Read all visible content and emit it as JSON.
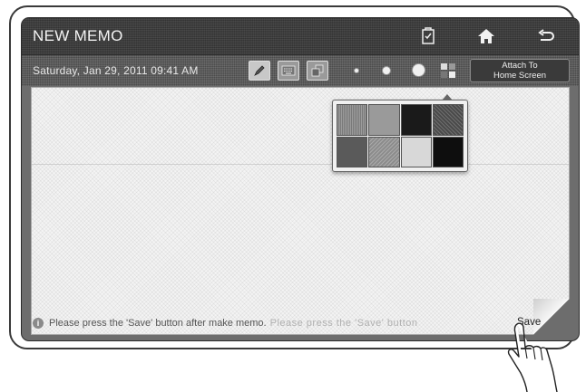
{
  "window": {
    "title": "NEW MEMO"
  },
  "header_icons": [
    "memo-clip-icon",
    "home-icon",
    "back-icon"
  ],
  "toolbar": {
    "datetime": "Saturday, Jan 29, 2011 09:41 AM",
    "tools": [
      "pen-tool-icon",
      "keyboard-tool-icon",
      "layers-tool-icon"
    ],
    "brush_sizes": [
      "small",
      "medium",
      "large"
    ],
    "color_picker_icon": "color-grid-icon",
    "attach_button": {
      "line1": "Attach To",
      "line2": "Home Screen"
    }
  },
  "palette": {
    "swatches": [
      "#7a7a7a",
      "#9a9a9a",
      "#1a1a1a",
      "#4a4a4a",
      "#5a5a5a",
      "#8c8c8c",
      "#d8d8d8",
      "#0e0e0e"
    ]
  },
  "memo": {
    "hint": "Please press the 'Save' button after make memo.",
    "hint_faded": "Please press the 'Save' button",
    "save_label": "Save"
  },
  "colors": {
    "frame": "#3a3a3a",
    "bar": "#3c3c3c",
    "paper": "#f4f4f4"
  }
}
